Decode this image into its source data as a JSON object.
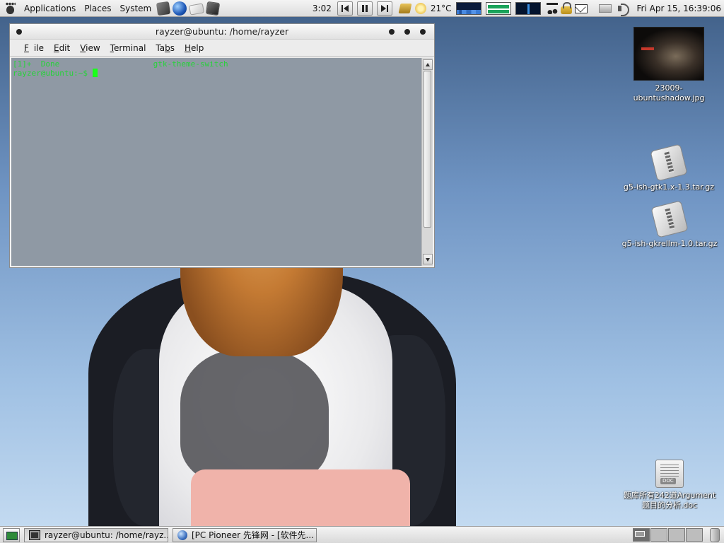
{
  "top_panel": {
    "menus": [
      "Applications",
      "Places",
      "System"
    ],
    "launchers": [
      "terminal-launcher-icon",
      "browser-globe-icon",
      "mail-launcher-icon",
      "app-launcher-icon"
    ],
    "tray_time": "3:02",
    "temperature": "21°C",
    "clock": "Fri Apr 15, 16:39:06"
  },
  "terminal": {
    "title": "rayzer@ubuntu: /home/rayzer",
    "menu": [
      {
        "mnemonic": "F",
        "rest": "ile"
      },
      {
        "mnemonic": "E",
        "rest": "dit"
      },
      {
        "mnemonic": "V",
        "rest": "iew"
      },
      {
        "mnemonic": "T",
        "rest": "erminal"
      },
      {
        "pre": "Ta",
        "mnemonic": "b",
        "rest": "s"
      },
      {
        "mnemonic": "H",
        "rest": "elp"
      }
    ],
    "lines": [
      "[1]+  Done                    gtk-theme-switch",
      "rayzer@ubuntu:~$ "
    ],
    "text_color": "#27d23a"
  },
  "desktop_icons": [
    {
      "label": "23009-\nubuntushadow.jpg",
      "kind": "image"
    },
    {
      "label": "g5-ish-gtk1.x-1.3.tar.gz",
      "kind": "archive"
    },
    {
      "label": "g5-ish-gkrellm-1.0.tar.gz",
      "kind": "archive"
    },
    {
      "label": "题库所有242道Argument\n题目的分析.doc",
      "kind": "document",
      "badge": "DOC"
    }
  ],
  "taskbar": {
    "tasks": [
      {
        "label": "rayzer@ubuntu: /home/rayz...",
        "icon": "terminal-icon",
        "active": true
      },
      {
        "label": "[PC Pioneer 先锋网 - [软件先...",
        "icon": "globe-icon",
        "active": false
      }
    ],
    "workspaces": 4,
    "active_workspace": 1
  }
}
